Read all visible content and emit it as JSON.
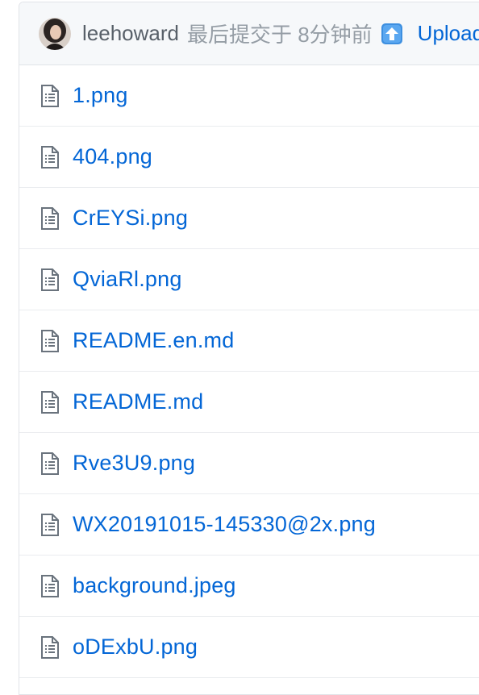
{
  "commit": {
    "author": "leehoward",
    "meta": "最后提交于 8分钟前",
    "emoji_icon": "arrow-up-emoji-icon",
    "message": "Upload"
  },
  "colors": {
    "link": "#0366d6",
    "muted": "#959da5",
    "header_bg": "#f6f8fa",
    "border": "#e1e4e8"
  },
  "files": [
    {
      "name": "1.png",
      "icon": "file-icon"
    },
    {
      "name": "404.png",
      "icon": "file-icon"
    },
    {
      "name": "CrEYSi.png",
      "icon": "file-icon"
    },
    {
      "name": "QviaRl.png",
      "icon": "file-icon"
    },
    {
      "name": "README.en.md",
      "icon": "file-icon"
    },
    {
      "name": "README.md",
      "icon": "file-icon"
    },
    {
      "name": "Rve3U9.png",
      "icon": "file-icon"
    },
    {
      "name": "WX20191015-145330@2x.png",
      "icon": "file-icon"
    },
    {
      "name": "background.jpeg",
      "icon": "file-icon"
    },
    {
      "name": "oDExbU.png",
      "icon": "file-icon"
    }
  ]
}
